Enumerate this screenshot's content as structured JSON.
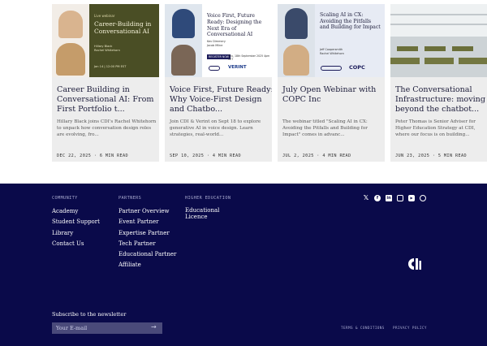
{
  "cards": [
    {
      "title": "Career Building in Conversational AI: From First Portfolio t...",
      "desc": "Hillary Black joins CDI's Rachel Whitehorn to unpack how conversation design roles are evolving, fro...",
      "meta": "DEC 22, 2025 · 6 MIN READ",
      "thumb": {
        "kicker": "Live webinar",
        "heading": "Career-Building in Conversational AI",
        "speakers": [
          "Hillary Black",
          "Rachel Whitehorn"
        ],
        "date_line": "Jan 14 | 12:00 PM EST",
        "bg": "#4a4e25"
      }
    },
    {
      "title": "Voice First, Future Ready: Why Voice-First Design and Chatbo...",
      "desc": "Join CDI & Verint on Sept 18 to explore generative AI in voice design. Learn strategies, real-world...",
      "meta": "SEP 10, 2025 · 4 MIN READ",
      "thumb": {
        "heading": "Voice First, Future Ready: Designing the Next Era of Conversational AI",
        "speakers": [
          "Kev Dimmery",
          "Jacob Milne"
        ],
        "date_line": "Thu, 18th September 2025 4pm CET",
        "badge": "REGISTER NOW",
        "partner": "VERINT",
        "bg": "#ffffff"
      }
    },
    {
      "title": "July Open Webinar with COPC Inc",
      "desc": "The webinar titled \"Scaling AI in CX: Avoiding the Pitfalls and Building for Impact\" comes in advanc...",
      "meta": "JUL 2, 2025 · 4 MIN READ",
      "thumb": {
        "heading": "Scaling AI in CX: Avoiding the Pitfalls and Building for Impact",
        "speakers": [
          "Jeff Coopersmith",
          "Rachel Whitehorn"
        ],
        "partner": "COPC",
        "bg": "#e7ebf4"
      }
    },
    {
      "title": "The Conversational Infrastructure: moving beyond the chatbot...",
      "desc": "Peter Thomas is Senior Adviser for Higher Education Strategy at CDI, where our focus is on building...",
      "meta": "JUN 23, 2025 · 5 MIN READ",
      "thumb": {
        "bg": "#cdd3d6"
      }
    }
  ],
  "footer": {
    "columns": [
      {
        "heading": "COMMUNITY",
        "links": [
          "Academy",
          "Student Support",
          "Library",
          "Contact Us"
        ]
      },
      {
        "heading": "PARTNERS",
        "links": [
          "Partner Overview",
          "Event Partner",
          "Expertise Partner",
          "Tech Partner",
          "Educational Partner",
          "Affiliate"
        ]
      },
      {
        "heading": "HIGHER EDUCATION",
        "links": [
          "Educational Licence"
        ]
      }
    ],
    "social": [
      "x-icon",
      "facebook-icon",
      "linkedin-icon",
      "instagram-icon",
      "youtube-icon",
      "whatsapp-icon"
    ],
    "newsletter_label": "Subscribe to the newsletter",
    "email_placeholder": "Your E-mail",
    "terms": "TERMS & CONDITIONS",
    "privacy": "PRIVACY POLICY"
  }
}
